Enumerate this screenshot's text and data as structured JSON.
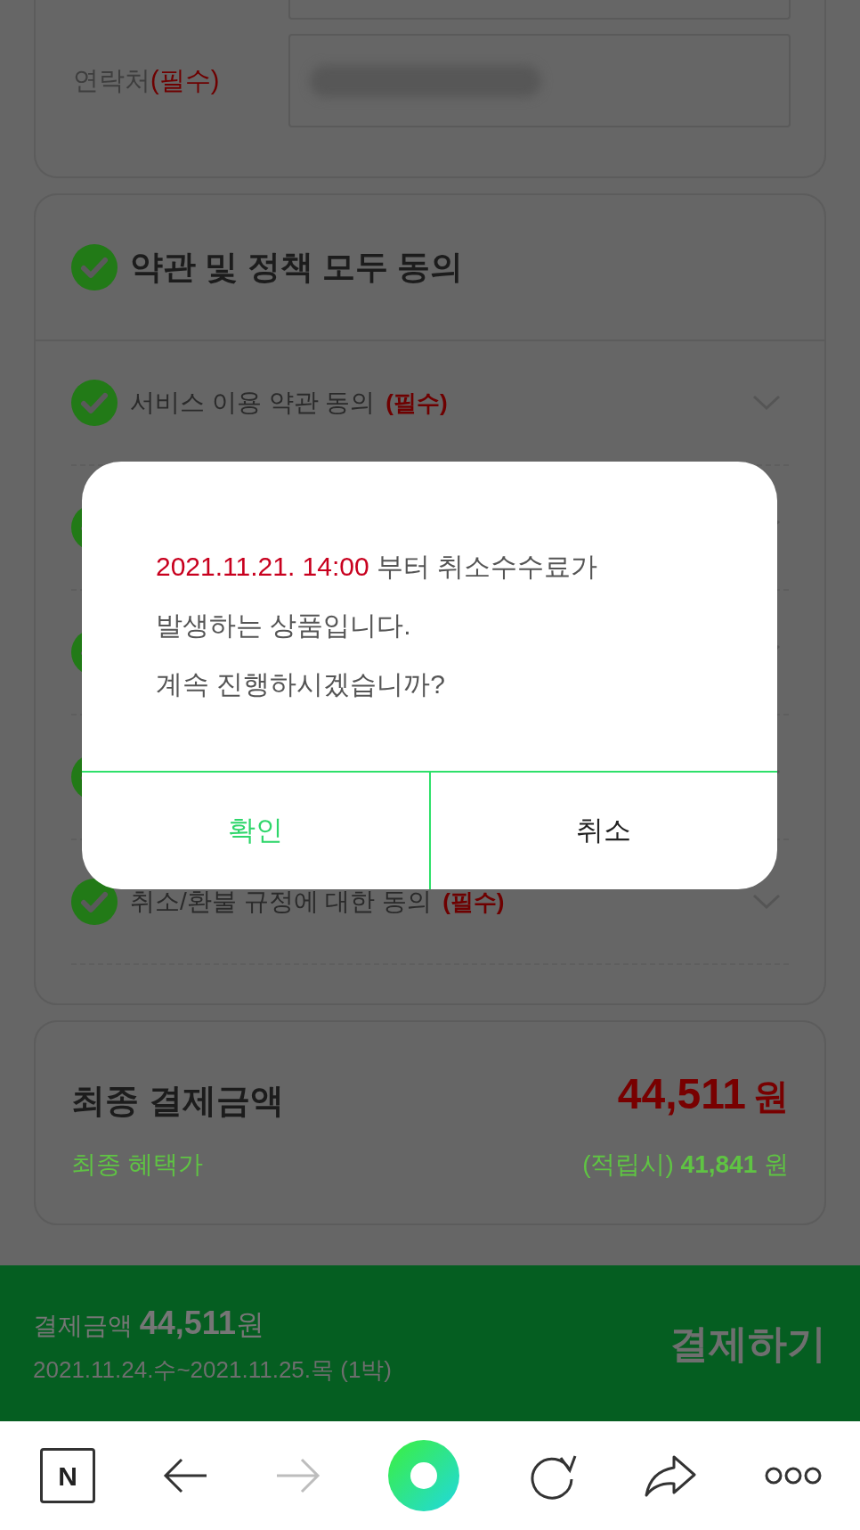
{
  "contact": {
    "label": "연락처",
    "required_mark": "(필수)"
  },
  "agreements": {
    "title": "약관 및 정책 모두 동의",
    "checked": true,
    "items": [
      {
        "label": "서비스 이용 약관 동의",
        "required_mark": "(필수)",
        "checked": true
      },
      {
        "checked": true
      },
      {
        "checked": true
      },
      {
        "checked": true
      },
      {
        "label": "취소/환불 규정에 대한 동의",
        "required_mark": "(필수)",
        "checked": true
      }
    ]
  },
  "final_price": {
    "title": "최종 결제금액",
    "amount": "44,511",
    "amount_unit": "원",
    "benefit_label": "최종 혜택가",
    "benefit_prefix": "(적립시)",
    "benefit_amount": "41,841",
    "benefit_unit": "원"
  },
  "pay_bar": {
    "label": "결제금액",
    "amount": "44,511",
    "unit": "원",
    "dates": "2021.11.24.수~2021.11.25.목 (1박)",
    "button": "결제하기"
  },
  "dialog": {
    "highlight": "2021.11.21. 14:00",
    "lines": [
      " 부터 취소수수료가",
      "발생하는 상품입니다.",
      "계속 진행하시겠습니까?"
    ],
    "buttons": [
      {
        "label": "확인",
        "kind": "primary"
      },
      {
        "label": "취소",
        "kind": "secondary"
      }
    ]
  },
  "browser_bar": {
    "logo_letter": "N",
    "items": [
      {
        "kind": "back",
        "disabled": false
      },
      {
        "kind": "forward",
        "disabled": true
      },
      {
        "kind": "home"
      },
      {
        "kind": "reload"
      },
      {
        "kind": "share"
      },
      {
        "kind": "more"
      }
    ]
  }
}
